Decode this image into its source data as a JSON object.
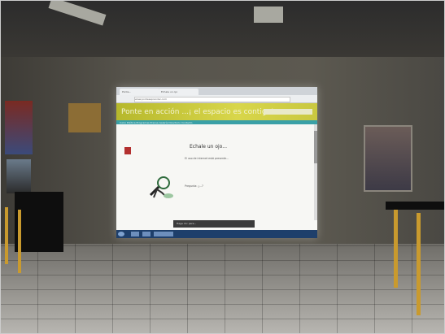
{
  "browser": {
    "tab_1": "Ponte...",
    "tab_2": "Echale un ojo",
    "url": "www.pontesaprender.com"
  },
  "site": {
    "title": "Ponte en acción ...¡ el espacio es contigo!",
    "nav": "Inicio   Política   Programas   Prensa   Galería   Directorio   Contacto"
  },
  "article": {
    "heading": "Echale un ojo...",
    "paragraph_1": "El uso de internet está presente...",
    "paragraph_2": "",
    "question": "Pregunta: ¿...?"
  },
  "overlay": {
    "tooltip": "Haga clic para..."
  },
  "taskbar": {
    "time": "",
    "date": ""
  },
  "colors": {
    "banner": "#c9c840",
    "nav": "#3aa0a6",
    "taskbar": "#1e3f6b"
  }
}
